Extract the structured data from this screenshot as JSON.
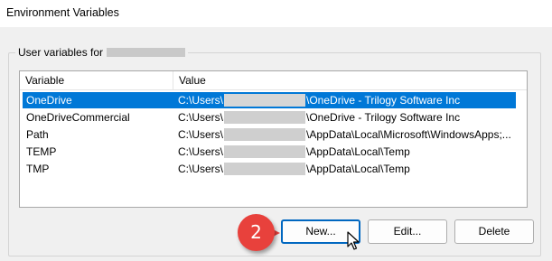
{
  "window": {
    "title": "Environment Variables"
  },
  "user_group": {
    "legend": "User variables for"
  },
  "table": {
    "columns": [
      "Variable",
      "Value"
    ],
    "rows": [
      {
        "variable": "OneDrive",
        "value_prefix": "C:\\Users\\",
        "value_suffix": "\\OneDrive - Trilogy Software Inc",
        "selected": true
      },
      {
        "variable": "OneDriveCommercial",
        "value_prefix": "C:\\Users\\",
        "value_suffix": "\\OneDrive - Trilogy Software Inc",
        "selected": false
      },
      {
        "variable": "Path",
        "value_prefix": "C:\\Users\\",
        "value_suffix": "\\AppData\\Local\\Microsoft\\WindowsApps;...",
        "selected": false
      },
      {
        "variable": "TEMP",
        "value_prefix": "C:\\Users\\",
        "value_suffix": "\\AppData\\Local\\Temp",
        "selected": false
      },
      {
        "variable": "TMP",
        "value_prefix": "C:\\Users\\",
        "value_suffix": "\\AppData\\Local\\Temp",
        "selected": false
      }
    ]
  },
  "buttons": {
    "new": "New...",
    "edit": "Edit...",
    "delete": "Delete"
  },
  "annotation": {
    "step": "2"
  },
  "colors": {
    "selection": "#0078d7",
    "badge": "#e8413c",
    "focus": "#0067c0"
  },
  "icons": {
    "cursor": "arrow-pointer-icon"
  }
}
